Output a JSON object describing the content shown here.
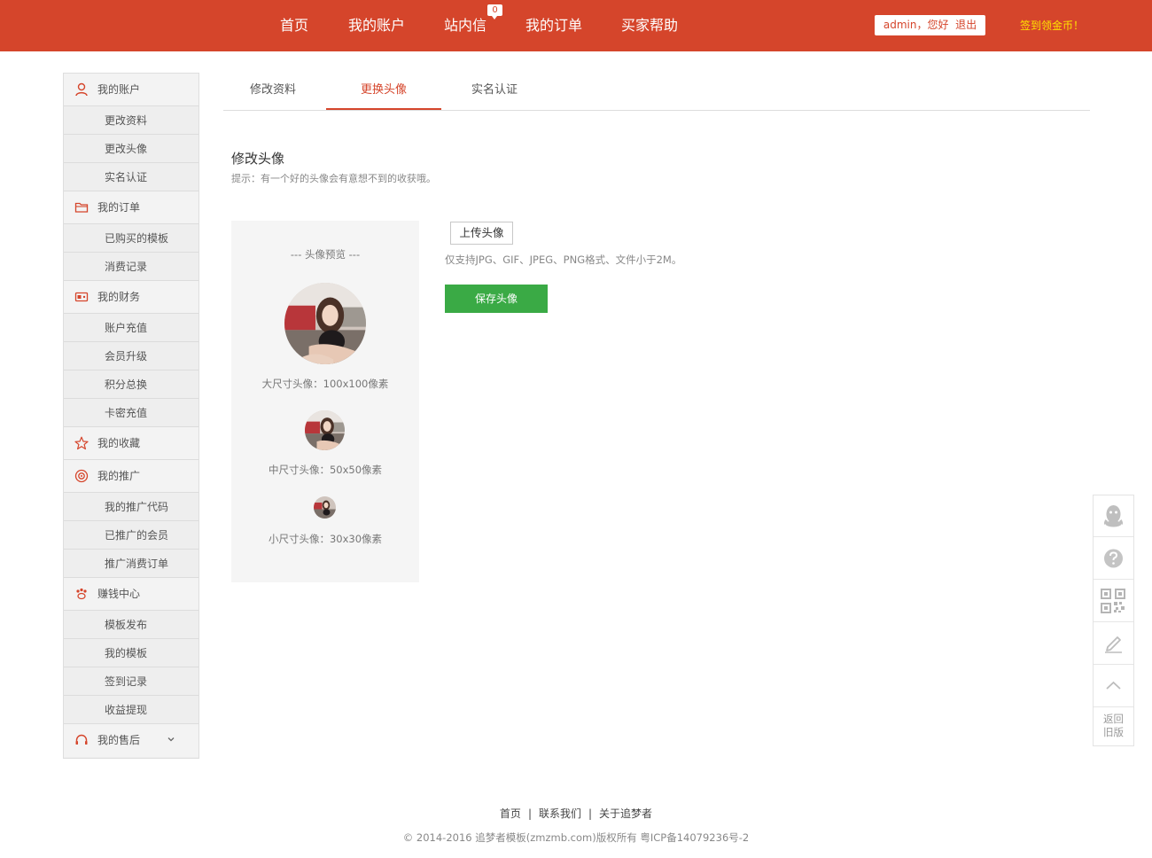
{
  "nav": {
    "items": [
      "首页",
      "我的账户",
      "站内信",
      "我的订单",
      "买家帮助"
    ],
    "msg_count": "0",
    "user": "admin",
    "greeting": "，您好",
    "logout": "退出",
    "signin": "签到领金币！"
  },
  "sidebar": {
    "groups": [
      {
        "label": "我的账户",
        "icon": "user-icon",
        "items": [
          "更改资料",
          "更改头像",
          "实名认证"
        ]
      },
      {
        "label": "我的订单",
        "icon": "folder-icon",
        "items": [
          "已购买的模板",
          "消费记录"
        ]
      },
      {
        "label": "我的财务",
        "icon": "wallet-icon",
        "items": [
          "账户充值",
          "会员升级",
          "积分总换",
          "卡密充值"
        ]
      },
      {
        "label": "我的收藏",
        "icon": "star-icon",
        "items": []
      },
      {
        "label": "我的推广",
        "icon": "target-icon",
        "items": [
          "我的推广代码",
          "已推广的会员",
          "推广消费订单"
        ]
      },
      {
        "label": "赚钱中心",
        "icon": "paw-icon",
        "items": [
          "模板发布",
          "我的模板",
          "签到记录",
          "收益提现"
        ]
      },
      {
        "label": "我的售后",
        "icon": "headset-icon",
        "items": []
      }
    ]
  },
  "tabs": [
    "修改资料",
    "更换头像",
    "实名认证"
  ],
  "active_tab": "更换头像",
  "main": {
    "title": "修改头像",
    "hint": "提示：有一个好的头像会有意想不到的收获哦。",
    "preview_title": "--- 头像预览 ---",
    "large_caption": "大尺寸头像：100x100像素",
    "medium_caption": "中尺寸头像：50x50像素",
    "small_caption": "小尺寸头像：30x30像素",
    "upload_button": "上传头像",
    "upload_hint": "仅支持JPG、GIF、JPEG、PNG格式、文件小于2M。",
    "save_button": "保存头像"
  },
  "floatbar": {
    "items": [
      "qq-icon",
      "help-icon",
      "qrcode-icon",
      "edit-icon",
      "back-to-top-icon"
    ],
    "back_line1": "返回",
    "back_line2": "旧版"
  },
  "footer": {
    "links": [
      "首页",
      "联系我们",
      "关于追梦者"
    ],
    "separator": "|",
    "copyright": "© 2014-2016 追梦者模板(zmzmb.com)版权所有 粤ICP备14079236号-2"
  },
  "colors": {
    "brand": "#d5452b",
    "signin": "#ffe400",
    "save": "#3aaa45"
  }
}
